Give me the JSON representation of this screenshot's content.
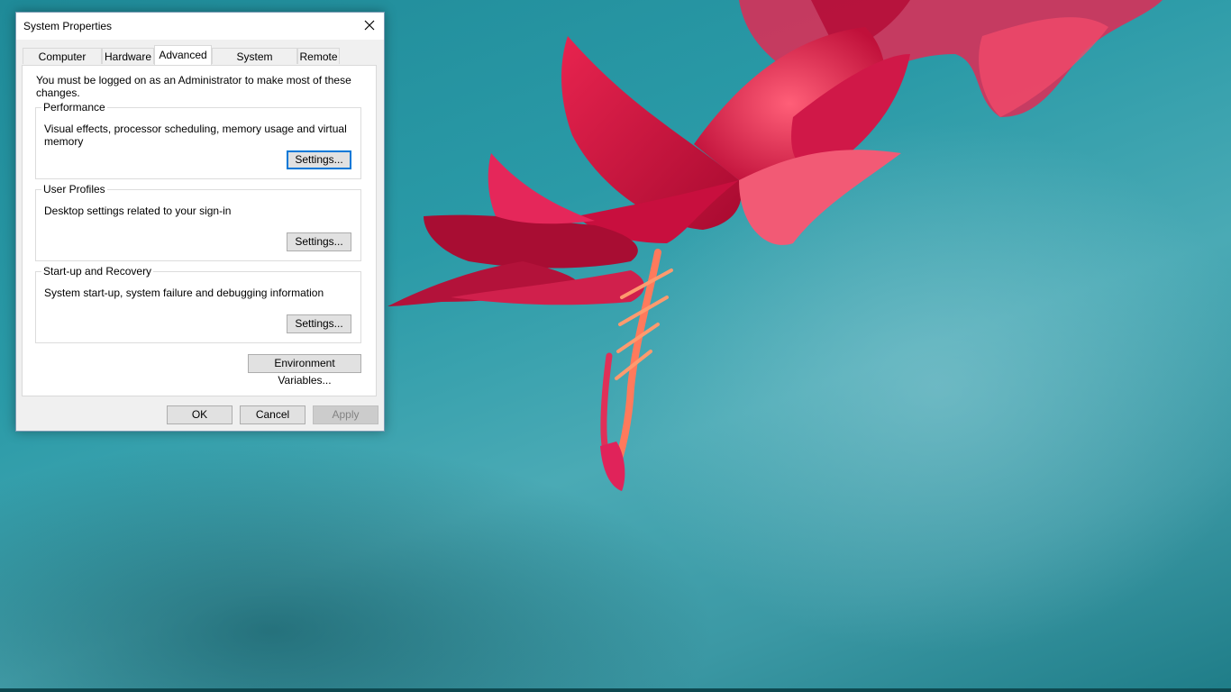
{
  "dialog": {
    "title": "System Properties",
    "tabs": [
      {
        "label": "Computer Name"
      },
      {
        "label": "Hardware"
      },
      {
        "label": "Advanced"
      },
      {
        "label": "System Protection"
      },
      {
        "label": "Remote"
      }
    ],
    "active_tab": "Advanced",
    "admin_note": "You must be logged on as an Administrator to make most of these changes.",
    "groups": {
      "performance": {
        "title": "Performance",
        "description": "Visual effects, processor scheduling, memory usage and virtual memory",
        "button": "Settings..."
      },
      "user_profiles": {
        "title": "User Profiles",
        "description": "Desktop settings related to your sign-in",
        "button": "Settings..."
      },
      "startup_recovery": {
        "title": "Start-up and Recovery",
        "description": "System start-up, system failure and debugging information",
        "button": "Settings..."
      }
    },
    "env_button": "Environment Variables...",
    "footer": {
      "ok": "OK",
      "cancel": "Cancel",
      "apply": "Apply"
    }
  },
  "theme": {
    "focus_color": "#0078d7",
    "desktop_color": "#2a9aa7",
    "flower_color": "#e0234e"
  },
  "icons": {
    "close": "close-icon"
  }
}
